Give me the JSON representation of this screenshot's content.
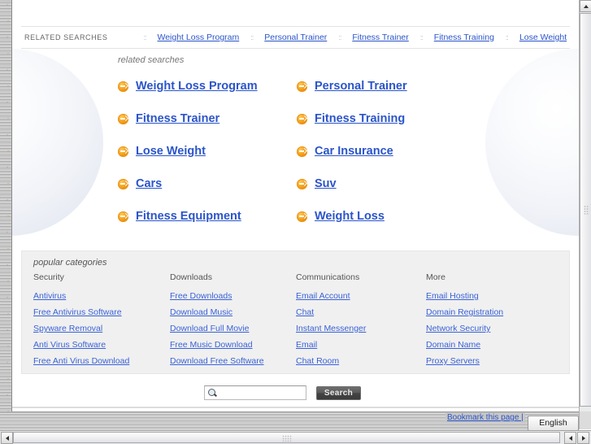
{
  "related_bar": {
    "label": "RELATED SEARCHES",
    "separator": "::",
    "links": [
      "Weight Loss Program",
      "Personal Trainer",
      "Fitness Trainer",
      "Fitness Training",
      "Lose Weight"
    ]
  },
  "related_searches": {
    "heading": "related searches",
    "items": [
      "Weight Loss Program",
      "Personal Trainer",
      "Fitness Trainer",
      "Fitness Training",
      "Lose Weight",
      "Car Insurance",
      "Cars",
      "Suv",
      "Fitness Equipment",
      "Weight Loss"
    ]
  },
  "popular_categories": {
    "heading": "popular categories",
    "columns": [
      {
        "header": "Security",
        "links": [
          "Antivirus",
          "Free Antivirus Software",
          "Spyware Removal",
          "Anti Virus Software",
          "Free Anti Virus Download"
        ]
      },
      {
        "header": "Downloads",
        "links": [
          "Free Downloads",
          "Download Music",
          "Download Full Movie",
          "Free Music Download",
          "Download Free Software"
        ]
      },
      {
        "header": "Communications",
        "links": [
          "Email Account",
          "Chat",
          "Instant Messenger",
          "Email",
          "Chat Room"
        ]
      },
      {
        "header": "More",
        "links": [
          "Email Hosting",
          "Domain Registration",
          "Network Security",
          "Domain Name",
          "Proxy Servers"
        ]
      }
    ]
  },
  "search": {
    "value": "",
    "placeholder": "",
    "button_label": "Search",
    "icon": "magnifier-icon"
  },
  "footer": {
    "bookmark_label": "Bookmark this page |",
    "language": "English"
  },
  "colors": {
    "link_blue": "#2b55c9",
    "accent_orange": "#f29b16",
    "panel_gray": "#f0f0f0"
  }
}
